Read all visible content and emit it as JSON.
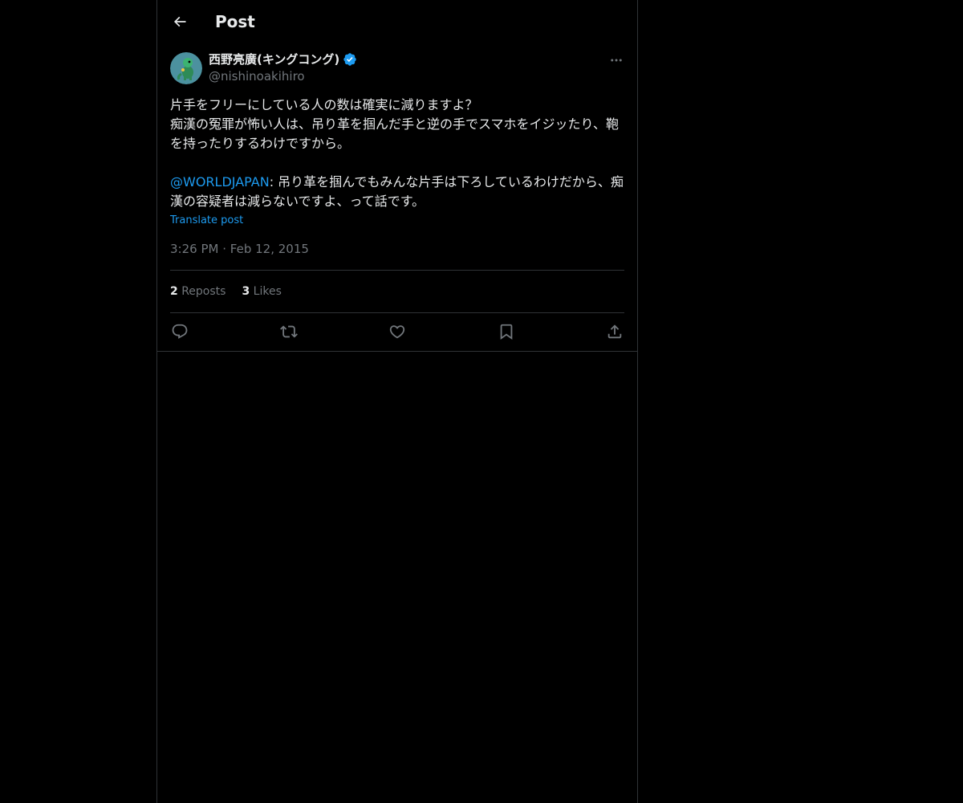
{
  "header": {
    "title": "Post",
    "back_icon": "arrow-left-icon"
  },
  "author": {
    "name": "西野亮廣(キングコング)",
    "handle": "@nishinoakihiro",
    "verified": true,
    "verified_color": "#1d9bf0",
    "avatar_icon": "dinosaur-avatar"
  },
  "post": {
    "line1": "片手をフリーにしている人の数は確実に減りますよ？",
    "line2": "痴漢の冤罪が怖い人は、吊り革を掴んだ手と逆の手でスマホをイジッたり、鞄を持ったりするわけですから。",
    "mention": "@WORLDJAPAN",
    "quote_text": ": 吊り革を掴んでもみんな片手は下ろしているわけだから、痴漢の容疑者は減らないですよ、って話です。",
    "translate_label": "Translate post",
    "time": "3:26 PM",
    "separator": "·",
    "date": "Feb 12, 2015"
  },
  "stats": {
    "reposts_count": "2",
    "reposts_label": "Reposts",
    "likes_count": "3",
    "likes_label": "Likes"
  },
  "actions": [
    {
      "icon": "reply-icon"
    },
    {
      "icon": "repost-icon"
    },
    {
      "icon": "like-icon"
    },
    {
      "icon": "bookmark-icon"
    },
    {
      "icon": "share-icon"
    }
  ],
  "colors": {
    "background": "#000000",
    "text": "#e7e9ea",
    "muted": "#71767b",
    "accent": "#1d9bf0",
    "border": "#2f3336"
  }
}
